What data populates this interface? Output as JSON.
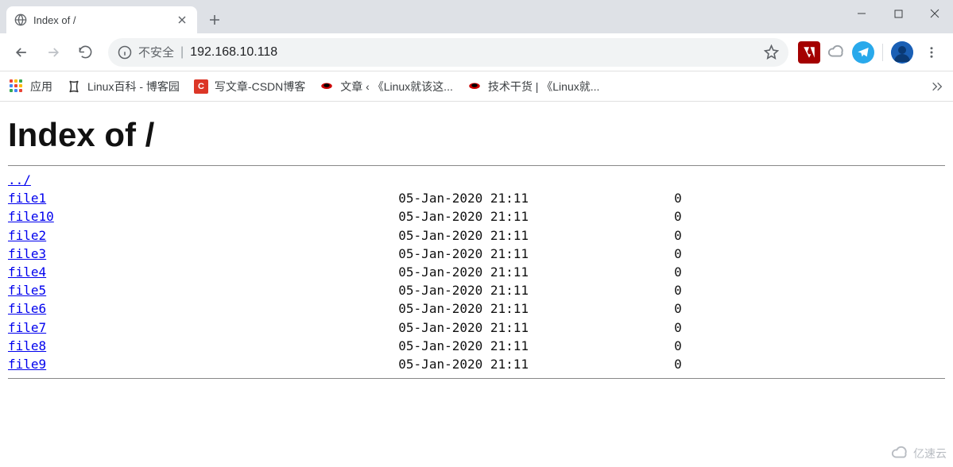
{
  "window": {
    "tab_title": "Index of /"
  },
  "omnibox": {
    "not_secure_label": "不安全",
    "url": "192.168.10.118"
  },
  "bookmarks": {
    "apps_label": "应用",
    "items": [
      {
        "label": "Linux百科 - 博客园",
        "icon": "cnblogs"
      },
      {
        "label": "写文章-CSDN博客",
        "icon": "csdn"
      },
      {
        "label": "文章 ‹ 《Linux就该这...",
        "icon": "redhat"
      },
      {
        "label": "技术干货 | 《Linux就...",
        "icon": "redhat"
      }
    ]
  },
  "page": {
    "heading": "Index of /",
    "parent_link": "../",
    "files": [
      {
        "name": "file1",
        "date": "05-Jan-2020 21:11",
        "size": "0"
      },
      {
        "name": "file10",
        "date": "05-Jan-2020 21:11",
        "size": "0"
      },
      {
        "name": "file2",
        "date": "05-Jan-2020 21:11",
        "size": "0"
      },
      {
        "name": "file3",
        "date": "05-Jan-2020 21:11",
        "size": "0"
      },
      {
        "name": "file4",
        "date": "05-Jan-2020 21:11",
        "size": "0"
      },
      {
        "name": "file5",
        "date": "05-Jan-2020 21:11",
        "size": "0"
      },
      {
        "name": "file6",
        "date": "05-Jan-2020 21:11",
        "size": "0"
      },
      {
        "name": "file7",
        "date": "05-Jan-2020 21:11",
        "size": "0"
      },
      {
        "name": "file8",
        "date": "05-Jan-2020 21:11",
        "size": "0"
      },
      {
        "name": "file9",
        "date": "05-Jan-2020 21:11",
        "size": "0"
      }
    ],
    "name_col_width": 51,
    "size_col_width": 20
  },
  "watermark": "亿速云"
}
